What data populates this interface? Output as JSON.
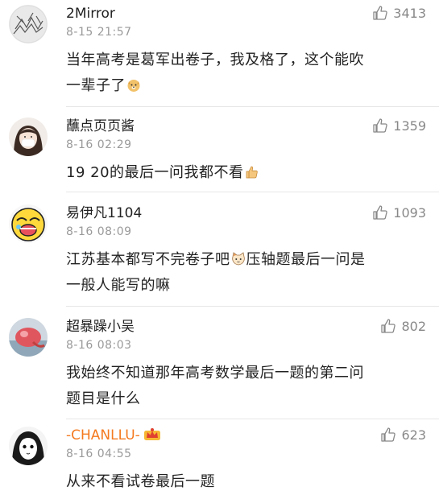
{
  "comments": [
    {
      "username": "2Mirror",
      "time": "8-15 21:57",
      "likes": "3413",
      "text_lines": [
        "当年高考是葛军出卷子，我及格了，这个能吹",
        "一辈子了"
      ],
      "emoji": "doge-emoji"
    },
    {
      "username": "蘸点页页酱",
      "time": "8-16 02:29",
      "likes": "1359",
      "text_lines": [
        "19 20的最后一问我都不看"
      ],
      "emoji": "thumbs-up-emoji"
    },
    {
      "username": "易伊凡1104",
      "time": "8-16 08:09",
      "likes": "1093",
      "text_lines": [
        "江苏基本都写不完卷子吧",
        "压轴题最后一问是",
        "一般人能写的嘛"
      ],
      "emoji": "cat-emoji"
    },
    {
      "username": "超暴躁小吴",
      "time": "8-16 08:03",
      "likes": "802",
      "text_lines": [
        "我始终不知道那年高考数学最后一题的第二问",
        "题目是什么"
      ]
    },
    {
      "username": "-CHANLLU-",
      "time": "8-16 04:55",
      "likes": "623",
      "text_lines": [
        "从来不看试卷最后一题"
      ],
      "badge": "crown-badge-icon"
    }
  ],
  "colors": {
    "username": "#222222",
    "username_vip": "#f47a20",
    "time": "#9a9a9a",
    "likes": "#888888",
    "text": "#222222"
  }
}
